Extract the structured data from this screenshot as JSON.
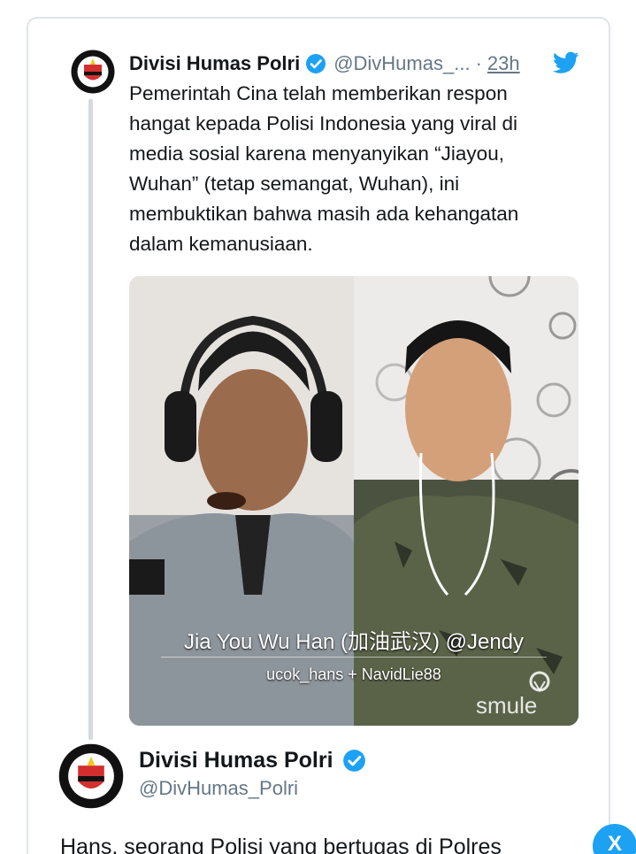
{
  "tweet": {
    "display_name": "Divisi Humas Polri",
    "handle": "@DivHumas_...",
    "separator": "·",
    "time": "23h",
    "text": "Pemerintah Cina telah memberikan respon hangat kepada Polisi Indonesia yang viral di media sosial karena menyanyikan “Jiayou, Wuhan” (tetap semangat, Wuhan), ini membuktikan bahwa masih ada kehangatan dalam kemanusiaan.",
    "verified_icon": "verified-badge-icon",
    "source_icon": "twitter-bird-icon"
  },
  "media": {
    "video_title": "Jia You Wu Han (加油武汉) @Jendy",
    "video_users": "ucok_hans + NavidLie88",
    "logo": "smule"
  },
  "second_tweet": {
    "display_name": "Divisi Humas Polri",
    "handle": "@DivHumas_Polri",
    "text_partial": "Hans, seorang Polisi yang bertugas di Polres"
  },
  "close_button": {
    "label": "X"
  },
  "colors": {
    "accent": "#1da1f2",
    "secondary_text": "#657786",
    "border": "#dfe4e9",
    "thread_line": "#d4dadf"
  }
}
